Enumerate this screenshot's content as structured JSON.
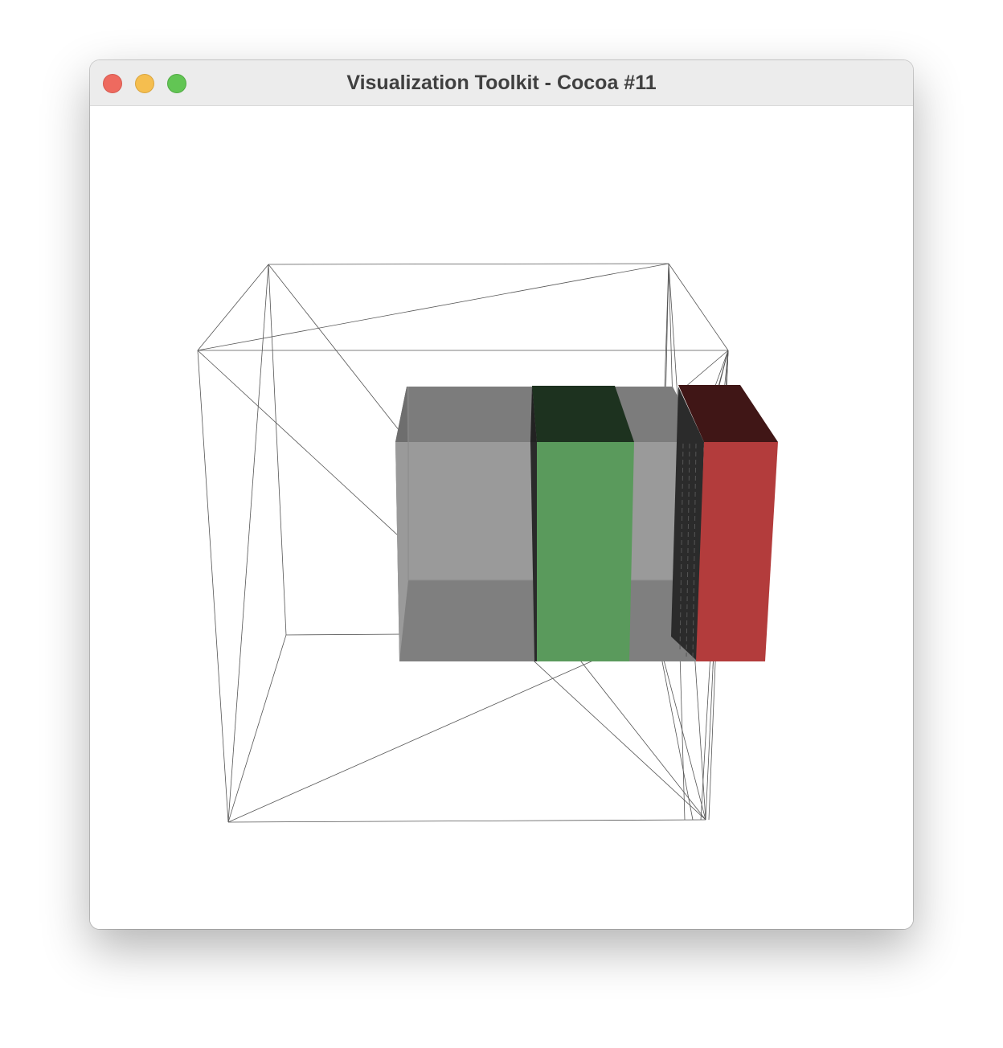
{
  "window": {
    "title": "Visualization Toolkit - Cocoa #11"
  },
  "colors": {
    "background": "#ffffff",
    "titlebar": "#ececec",
    "close": "#ee6a5f",
    "minimize": "#f5be4f",
    "zoom": "#62c554",
    "gray_box": "#9a9a9a",
    "green_box": "#5a9a5c",
    "red_box": "#b33c3c",
    "wireframe": "#555555"
  },
  "scene": {
    "objects": [
      "wireframe-cube",
      "gray-box",
      "green-box",
      "red-box"
    ]
  }
}
